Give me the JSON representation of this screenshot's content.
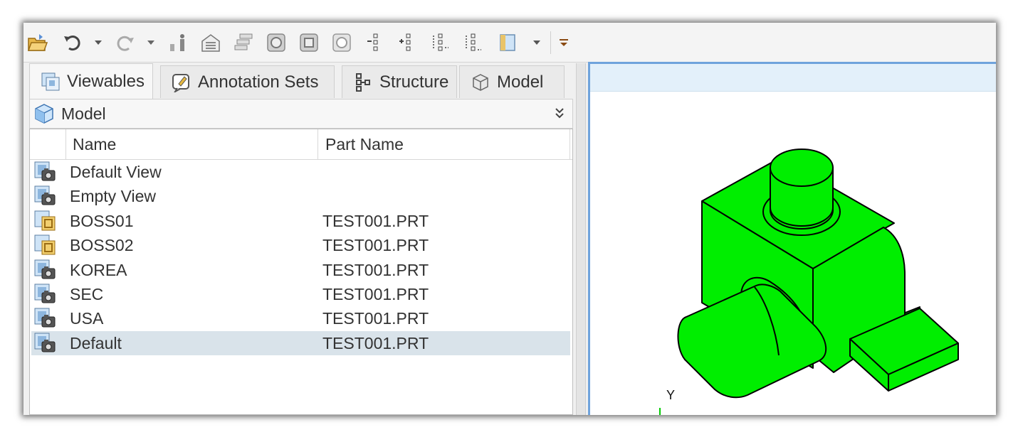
{
  "toolbar": {
    "icons": [
      "open-folder-icon",
      "undo-icon",
      "undo-dropdown-icon",
      "redo-icon",
      "redo-dropdown-icon",
      "figure-icon",
      "house-list-icon",
      "stack-list-icon",
      "view-fit-icon",
      "view-shaded-icon",
      "view-hidden-icon",
      "tree-expand-icon",
      "tree-collapse-icon",
      "tree-dotted-icon",
      "tree-dotted-2-icon",
      "sheet-icon",
      "sheet-dropdown-icon",
      "customize-toolbar-icon"
    ]
  },
  "tabs": [
    {
      "label": "Viewables",
      "icon": "viewables-icon",
      "active": true
    },
    {
      "label": "Annotation Sets",
      "icon": "annotation-sets-icon",
      "active": false
    },
    {
      "label": "Structure",
      "icon": "structure-icon",
      "active": false
    },
    {
      "label": "Model",
      "icon": "model-cube-icon",
      "active": false
    }
  ],
  "model_bar": {
    "label": "Model",
    "icon": "model-cube-icon",
    "collapse_icon": "double-chevron-icon"
  },
  "table": {
    "columns": [
      "Name",
      "Part Name"
    ],
    "rows": [
      {
        "name": "Default View",
        "part": "",
        "icon": "view-camera-icon"
      },
      {
        "name": "Empty View",
        "part": "",
        "icon": "view-camera-icon"
      },
      {
        "name": "BOSS01",
        "part": "TEST001.PRT",
        "icon": "view-folder-icon"
      },
      {
        "name": "BOSS02",
        "part": "TEST001.PRT",
        "icon": "view-folder-icon"
      },
      {
        "name": "KOREA",
        "part": "TEST001.PRT",
        "icon": "view-camera-icon"
      },
      {
        "name": "SEC",
        "part": "TEST001.PRT",
        "icon": "view-camera-icon"
      },
      {
        "name": "USA",
        "part": "TEST001.PRT",
        "icon": "view-camera-icon"
      },
      {
        "name": "Default",
        "part": "TEST001.PRT",
        "icon": "view-camera-icon",
        "selected": true
      }
    ]
  },
  "viewport": {
    "axis_label": "Y",
    "model_color": "#00ee00"
  },
  "colors": {
    "accent": "#6fa3dc",
    "selection": "#d9e3ea"
  }
}
